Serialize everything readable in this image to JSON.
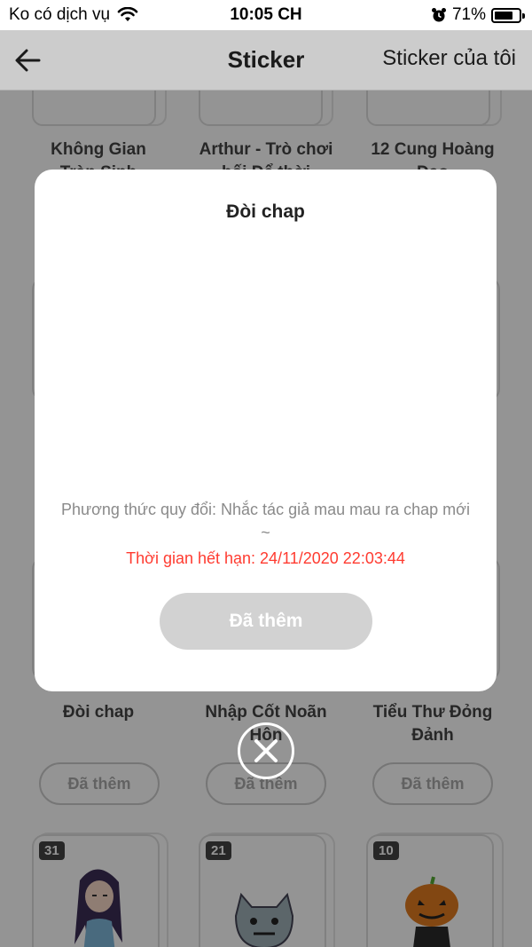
{
  "status_bar": {
    "carrier": "Ko có dịch vụ",
    "time": "10:05 CH",
    "battery": "71%"
  },
  "nav": {
    "title": "Sticker",
    "right_action": "Sticker của tôi"
  },
  "grid": {
    "row1": [
      {
        "name_l1": "Không Gian",
        "name_l2": "Tràn Sinh"
      },
      {
        "name_l1": "Arthur - Trò chơi",
        "name_l2": "bối Để thời"
      },
      {
        "name_l1": "12 Cung Hoàng",
        "name_l2": "Đạo"
      }
    ],
    "row3": [
      {
        "name_l1": "Đòi chap",
        "name_l2": "",
        "button": "Đã thêm"
      },
      {
        "name_l1": "Nhập Cốt Noãn",
        "name_l2": "Hôn",
        "button": "Đã thêm"
      },
      {
        "name_l1": "Tiểu Thư Đỏng",
        "name_l2": "Đảnh",
        "button": "Đã thêm"
      }
    ],
    "row4": [
      {
        "count": "31"
      },
      {
        "count": "21"
      },
      {
        "count": "10"
      }
    ]
  },
  "modal": {
    "title": "Đòi chap",
    "description": "Phương thức quy đổi: Nhắc tác giả mau mau ra chap mới ~",
    "expiry": "Thời gian hết hạn: 24/11/2020 22:03:44",
    "button": "Đã thêm"
  },
  "colors": {
    "expiry": "#ff3b30",
    "button_disabled": "#d2d2d2",
    "overlay": "rgba(0,0,0,0.42)"
  }
}
